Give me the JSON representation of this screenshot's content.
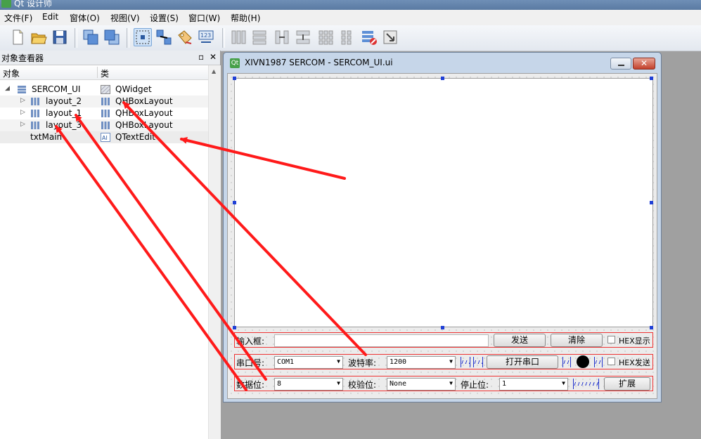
{
  "app": {
    "title": "Qt 设计师"
  },
  "menu": [
    "文件(F)",
    "Edit",
    "窗体(O)",
    "视图(V)",
    "设置(S)",
    "窗口(W)",
    "帮助(H)"
  ],
  "inspector": {
    "title": "对象查看器",
    "col_object": "对象",
    "col_class": "类",
    "rows": [
      {
        "name": "SERCOM_UI",
        "cls": "QWidget"
      },
      {
        "name": "layout_2",
        "cls": "QHBoxLayout"
      },
      {
        "name": "layout_1",
        "cls": "QHBoxLayout"
      },
      {
        "name": "layout_3",
        "cls": "QHBoxLayout"
      },
      {
        "name": "txtMain",
        "cls": "QTextEdit"
      }
    ]
  },
  "form": {
    "title": "XIVN1987 SERCOM - SERCOM_UI.ui",
    "row1": {
      "input_label": "输入框:",
      "send": "发送",
      "clear": "清除",
      "hex_show": "HEX显示"
    },
    "row2": {
      "port_label": "串口号:",
      "port_value": "COM1",
      "baud_label": "波特率:",
      "baud_value": "1200",
      "open": "打开串口",
      "hex_send": "HEX发送"
    },
    "row3": {
      "data_label": "数据位:",
      "data_value": "8",
      "parity_label": "校验位:",
      "parity_value": "None",
      "stop_label": "停止位:",
      "stop_value": "1",
      "expand": "扩展"
    }
  },
  "icons": [
    "new-file-icon",
    "open-folder-icon",
    "save-icon",
    "send-to-back-icon",
    "bring-to-front-icon",
    "edit-widgets-icon",
    "edit-signals-icon",
    "edit-buddies-icon",
    "edit-tab-order-icon",
    "horizontal-layout-icon",
    "vertical-layout-icon",
    "horizontal-splitter-icon",
    "vertical-splitter-icon",
    "grid-layout-icon",
    "form-layout-icon",
    "break-layout-icon",
    "adjust-size-icon"
  ],
  "colors": {
    "annotation_arrow": "#ff0000",
    "selection_handle": "#1f3fd6"
  }
}
